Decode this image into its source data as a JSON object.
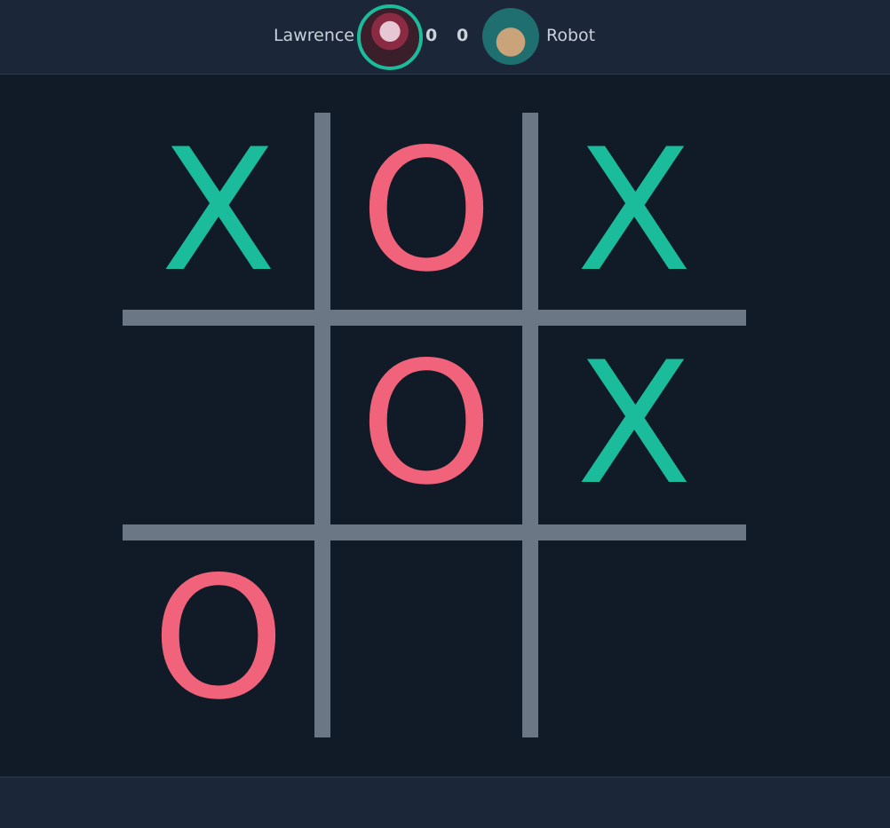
{
  "players": [
    {
      "name": "Lawrence",
      "score": "0",
      "avatar": "player-avatar-portrait"
    },
    {
      "name": "Robot",
      "score": "0",
      "avatar": "robot-avatar-portrait"
    }
  ],
  "board": {
    "cells": [
      "X",
      "O",
      "X",
      "",
      "O",
      "X",
      "O",
      "",
      ""
    ]
  },
  "colors": {
    "x": "#1bbc9b",
    "o": "#f0637a",
    "grid": "#6b7785",
    "background": "#111a27",
    "bar": "#1b2638",
    "active_ring": "#1bbc9b"
  }
}
